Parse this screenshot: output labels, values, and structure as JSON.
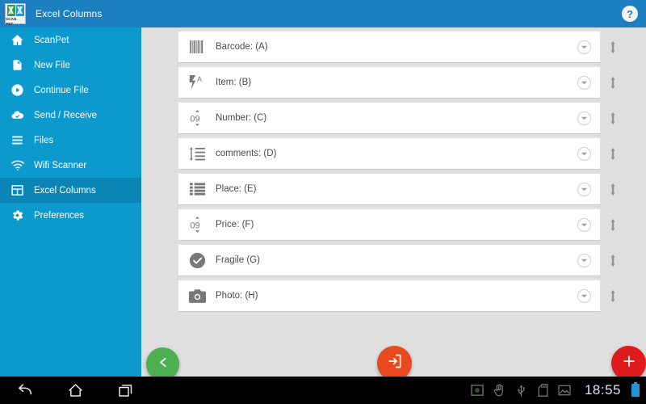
{
  "titlebar": {
    "app_name": "Excel Columns",
    "icon_caption": "SCAN PET",
    "help_label": "?",
    "icon_name": "scanpet-app-icon",
    "accent": "#1C7FBF"
  },
  "sidebar": {
    "background": "#0B99CE",
    "selected_background": "#0A85B5",
    "items": [
      {
        "label": "ScanPet",
        "icon": "home-icon",
        "selected": false
      },
      {
        "label": "New File",
        "icon": "document-icon",
        "selected": false
      },
      {
        "label": "Continue File",
        "icon": "play-circle-icon",
        "selected": false
      },
      {
        "label": "Send / Receive",
        "icon": "cloud-check-icon",
        "selected": false
      },
      {
        "label": "Files",
        "icon": "list-icon",
        "selected": false
      },
      {
        "label": "Wifi Scanner",
        "icon": "wifi-icon",
        "selected": false
      },
      {
        "label": "Excel Columns",
        "icon": "grid-table-icon",
        "selected": true
      },
      {
        "label": "Preferences",
        "icon": "gear-icon",
        "selected": false
      }
    ]
  },
  "content": {
    "background": "#DFDFDF",
    "rows": [
      {
        "label": "Barcode: (A)",
        "icon": "barcode-icon"
      },
      {
        "label": "Item: (B)",
        "icon": "text-auto-icon"
      },
      {
        "label": "Number: (C)",
        "icon": "number-stepper-icon"
      },
      {
        "label": "comments: (D)",
        "icon": "line-spacing-icon"
      },
      {
        "label": "Place: (E)",
        "icon": "list-rows-icon"
      },
      {
        "label": "Price: (F)",
        "icon": "number-stepper-icon"
      },
      {
        "label": "Fragile (G)",
        "icon": "check-circle-icon"
      },
      {
        "label": "Photo: (H)",
        "icon": "camera-icon"
      }
    ],
    "row_expand_icon": "chevron-down-icon",
    "row_drag_icon": "reorder-handle-icon"
  },
  "actions": {
    "back": {
      "name": "back-button",
      "icon": "arrow-left-icon",
      "color": "#4CAF50"
    },
    "exit": {
      "name": "exit-button",
      "icon": "exit-door-icon",
      "color": "#E8491D"
    },
    "add": {
      "name": "add-button",
      "icon": "plus-icon",
      "color": "#E01B1B"
    }
  },
  "system_bar": {
    "nav": [
      {
        "label": "Back",
        "icon": "nav-back-icon"
      },
      {
        "label": "Home",
        "icon": "nav-home-icon"
      },
      {
        "label": "Recents",
        "icon": "nav-recents-icon"
      }
    ],
    "status_icons": [
      "screenshot-icon",
      "gesture-hand-icon",
      "usb-icon",
      "sd-card-icon",
      "image-icon"
    ],
    "clock": "18:55",
    "battery_icon": "battery-icon"
  }
}
